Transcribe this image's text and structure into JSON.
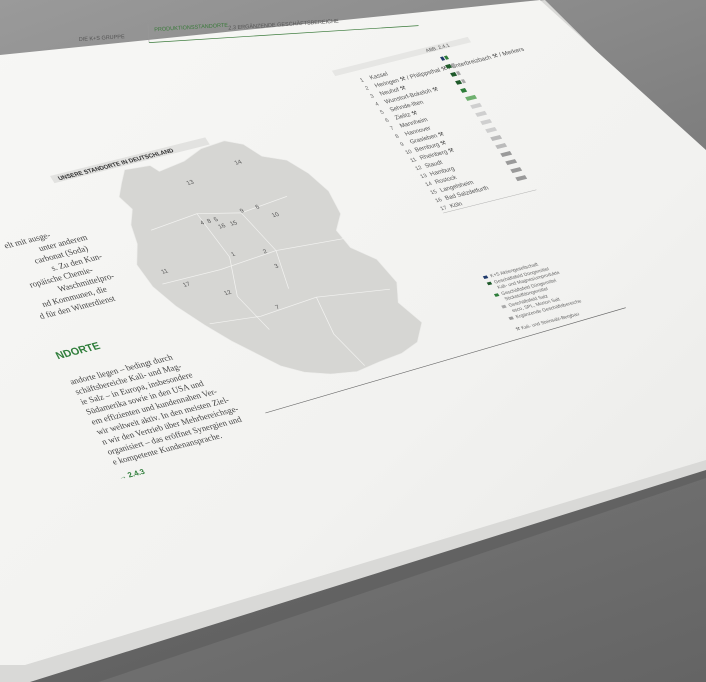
{
  "header": {
    "left_label": "DIE K+S GRUPPE",
    "tab_label": "PRODUKTIONSSTANDORTE",
    "right_label": "2.3 ERGÄNZENDE GESCHÄFTSBEREICHE"
  },
  "figure": {
    "abb_label": "ABB. 2.4.1",
    "map_title": "UNSERE STANDORTE IN DEUTSCHLAND",
    "sites": [
      {
        "num": "1",
        "name": "Kassel"
      },
      {
        "num": "2",
        "name": "Heringen ⚒ / Philippsthal ⚒ / Unterbreizbach ⚒ / Merkers"
      },
      {
        "num": "3",
        "name": "Neuhof ⚒"
      },
      {
        "num": "4",
        "name": "Wunstorf-Bokeloh ⚒"
      },
      {
        "num": "5",
        "name": "Sehnde-Ilten"
      },
      {
        "num": "6",
        "name": "Zielitz ⚒"
      },
      {
        "num": "7",
        "name": "Mannheim"
      },
      {
        "num": "8",
        "name": "Hannover"
      },
      {
        "num": "9",
        "name": "Grasleben ⚒"
      },
      {
        "num": "10",
        "name": "Bernburg ⚒"
      },
      {
        "num": "11",
        "name": "Rheinberg ⚒"
      },
      {
        "num": "12",
        "name": "Staudt"
      },
      {
        "num": "13",
        "name": "Hamburg"
      },
      {
        "num": "14",
        "name": "Rostock"
      },
      {
        "num": "15",
        "name": "Langelsheim"
      },
      {
        "num": "16",
        "name": "Bad Salzdetfurth"
      },
      {
        "num": "17",
        "name": "Köln"
      }
    ],
    "map_numbers": [
      "14",
      "13",
      "4",
      "8",
      "5",
      "16",
      "15",
      "9",
      "6",
      "10",
      "11",
      "17",
      "12",
      "1",
      "2",
      "3",
      "7"
    ],
    "key": [
      {
        "text": "K+S Aktiengesellschaft",
        "color": "#1f3a6b"
      },
      {
        "text": "Geschäftsfeld Düngemittel",
        "color": "#1f5a2b"
      },
      {
        "text": "Kali- und Magnesiumprodukte",
        "color": "#2e7d3a"
      },
      {
        "text": "Geschäftsfeld Düngemittel",
        "color": "#2e7d3a"
      },
      {
        "text": "Stickstoffdüngemittel",
        "color": "#6fb06f"
      },
      {
        "text": "Geschäftsfeld Salz",
        "color": "#a8a8a8"
      },
      {
        "text": "esco, SPL, Morton Salt",
        "color": "#bdbdbd"
      },
      {
        "text": "Ergänzende Geschäftsbereiche",
        "color": "#9a9a9a"
      },
      {
        "text": "⚒ Kali- und Steinsalz-Bergbau",
        "color": ""
      }
    ]
  },
  "text_column": {
    "lines_top": [
      "elt mit ausge-",
      "unter anderem",
      "carbonat (Soda)",
      "s. Zu den Kun-",
      "ropäische Chemie-",
      "Waschmittelpro-",
      "nd Kommunen, die",
      "d für den Winterdienst"
    ],
    "heading": "NDORTE",
    "lines_bottom": [
      "andorte liegen – bedingt durch",
      "schäftsbereiche Kali- und Mag-",
      "ie Salz – in Europa, insbesondere",
      "Südamerika sowie in den USA und",
      "em effizienten und kundennahen Ver-",
      "wir weltweit aktiv. In den meisten Ziel-",
      "n wir den Vertrieb über Mehrbereichsge-",
      "organisiert – das eröffnet Synergien und",
      "e kompetente Kundenansprache."
    ],
    "ref": "→ 2.4.3"
  }
}
